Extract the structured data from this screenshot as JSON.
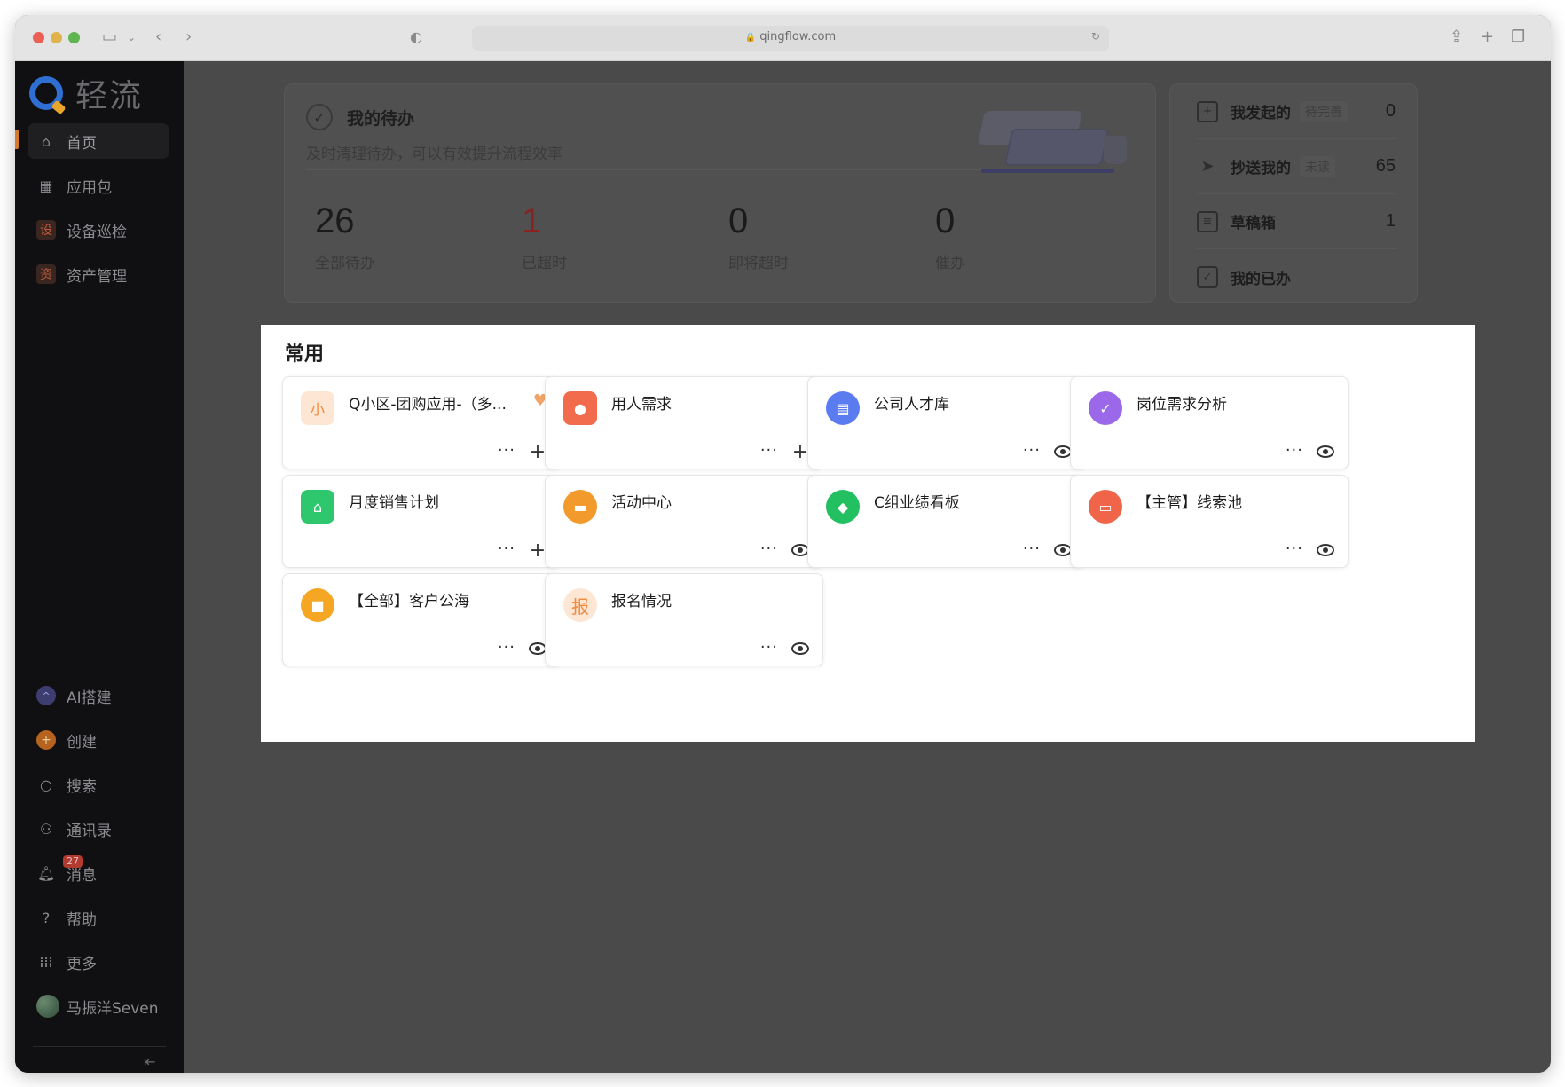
{
  "browser": {
    "url": "qingflow.com"
  },
  "sidebar": {
    "logo_text": "轻流",
    "top_items": [
      {
        "label": "首页",
        "icon": "home-icon"
      },
      {
        "label": "应用包",
        "icon": "grid-icon"
      },
      {
        "label": "设备巡检",
        "icon_text": "设"
      },
      {
        "label": "资产管理",
        "icon_text": "资"
      }
    ],
    "bottom_items": [
      {
        "label": "AI搭建",
        "icon": "ai-icon"
      },
      {
        "label": "创建",
        "icon": "plus-circle-icon"
      },
      {
        "label": "搜索",
        "icon": "search-icon"
      },
      {
        "label": "通讯录",
        "icon": "contacts-icon"
      },
      {
        "label": "消息",
        "icon": "bell-icon",
        "badge": "27"
      },
      {
        "label": "帮助",
        "icon": "help-icon"
      },
      {
        "label": "更多",
        "icon": "dots-grid-icon"
      },
      {
        "label": "马振洋Seven",
        "icon": "avatar"
      }
    ]
  },
  "todo": {
    "title": "我的待办",
    "subtitle": "及时清理待办，可以有效提升流程效率",
    "stats": [
      {
        "value": "26",
        "label": "全部待办"
      },
      {
        "value": "1",
        "label": "已超时"
      },
      {
        "value": "0",
        "label": "即将超时"
      },
      {
        "value": "0",
        "label": "催办"
      }
    ]
  },
  "mine": [
    {
      "label": "我发起的",
      "tag": "待完善",
      "count": "0"
    },
    {
      "label": "抄送我的",
      "tag": "未读",
      "count": "65"
    },
    {
      "label": "草稿箱",
      "tag": "",
      "count": "1"
    },
    {
      "label": "我的已办",
      "tag": "",
      "count": ""
    }
  ],
  "common": {
    "title": "常用",
    "apps": [
      {
        "name": "Q小区-团购应用-（多...",
        "icon_text": "小",
        "color": "#fde6d4",
        "action": "plus",
        "fav": true
      },
      {
        "name": "用人需求",
        "color": "#f26b4d",
        "action": "plus"
      },
      {
        "name": "公司人才库",
        "color": "#5b7cf0",
        "action": "eye"
      },
      {
        "name": "岗位需求分析",
        "color": "#9a68e8",
        "action": "eye"
      },
      {
        "name": "月度销售计划",
        "color": "#2fc76e",
        "action": "plus"
      },
      {
        "name": "活动中心",
        "color": "#f39a2c",
        "action": "eye"
      },
      {
        "name": "C组业绩看板",
        "color": "#23c061",
        "action": "eye"
      },
      {
        "name": "【主管】线索池",
        "color": "#f06449",
        "action": "eye"
      },
      {
        "name": "【全部】客户公海",
        "color": "#f5a623",
        "action": "eye"
      },
      {
        "name": "报名情况",
        "icon_text": "报",
        "color": "#fde6d4",
        "action": "eye"
      }
    ]
  },
  "colors": {
    "accent": "#d57a2c",
    "overlay": "#4a4a4a"
  }
}
